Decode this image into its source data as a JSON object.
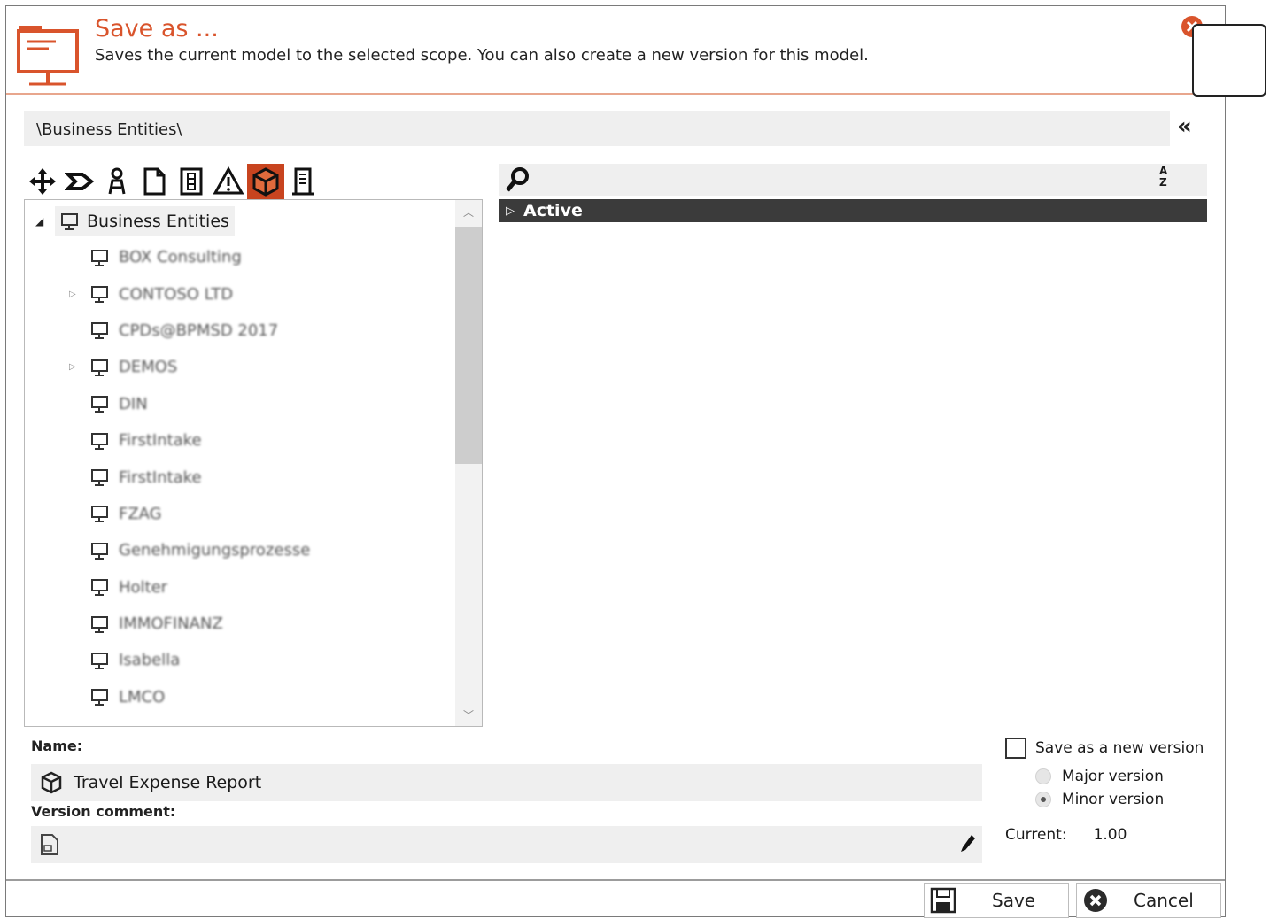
{
  "header": {
    "title": "Save as ...",
    "description": "Saves the current model to the selected scope. You can also create a new version for this model.",
    "accent_color": "#d9542c",
    "icon": "model-board-icon"
  },
  "path": {
    "text": "\\Business Entities\\",
    "collapse_label": "«"
  },
  "toolbar": {
    "icons": [
      "move-icon",
      "process-icon",
      "person-icon",
      "document-icon",
      "gauge-icon",
      "warning-icon",
      "cube-icon",
      "building-icon"
    ],
    "active_index": 6
  },
  "tree": {
    "root": {
      "label": "Business Entities"
    },
    "items": [
      {
        "label": "BOX Consulting",
        "expandable": false
      },
      {
        "label": "CONTOSO LTD",
        "expandable": true
      },
      {
        "label": "CPDs@BPMSD 2017",
        "expandable": false
      },
      {
        "label": "DEMOS",
        "expandable": true
      },
      {
        "label": "DIN",
        "expandable": false
      },
      {
        "label": "FirstIntake",
        "expandable": false
      },
      {
        "label": "FirstIntake",
        "expandable": false
      },
      {
        "label": "FZAG",
        "expandable": false
      },
      {
        "label": "Genehmigungsprozesse",
        "expandable": false
      },
      {
        "label": "Holter",
        "expandable": false
      },
      {
        "label": "IMMOFINANZ",
        "expandable": false
      },
      {
        "label": "Isabella",
        "expandable": false
      },
      {
        "label": "LMCO",
        "expandable": false
      }
    ]
  },
  "list": {
    "group_label": "Active",
    "sort_icon": "sort-az-icon",
    "sort_label_top": "A",
    "sort_label_bottom": "Z"
  },
  "form": {
    "name_label": "Name:",
    "name_value": "Travel Expense Report",
    "comment_label": "Version comment:",
    "comment_value": ""
  },
  "version": {
    "save_new_label": "Save as a new version",
    "save_new_checked": false,
    "major_label": "Major version",
    "minor_label": "Minor version",
    "selected": "minor",
    "current_label": "Current:",
    "current_value": "1.00"
  },
  "buttons": {
    "save_label": "Save",
    "cancel_label": "Cancel"
  }
}
